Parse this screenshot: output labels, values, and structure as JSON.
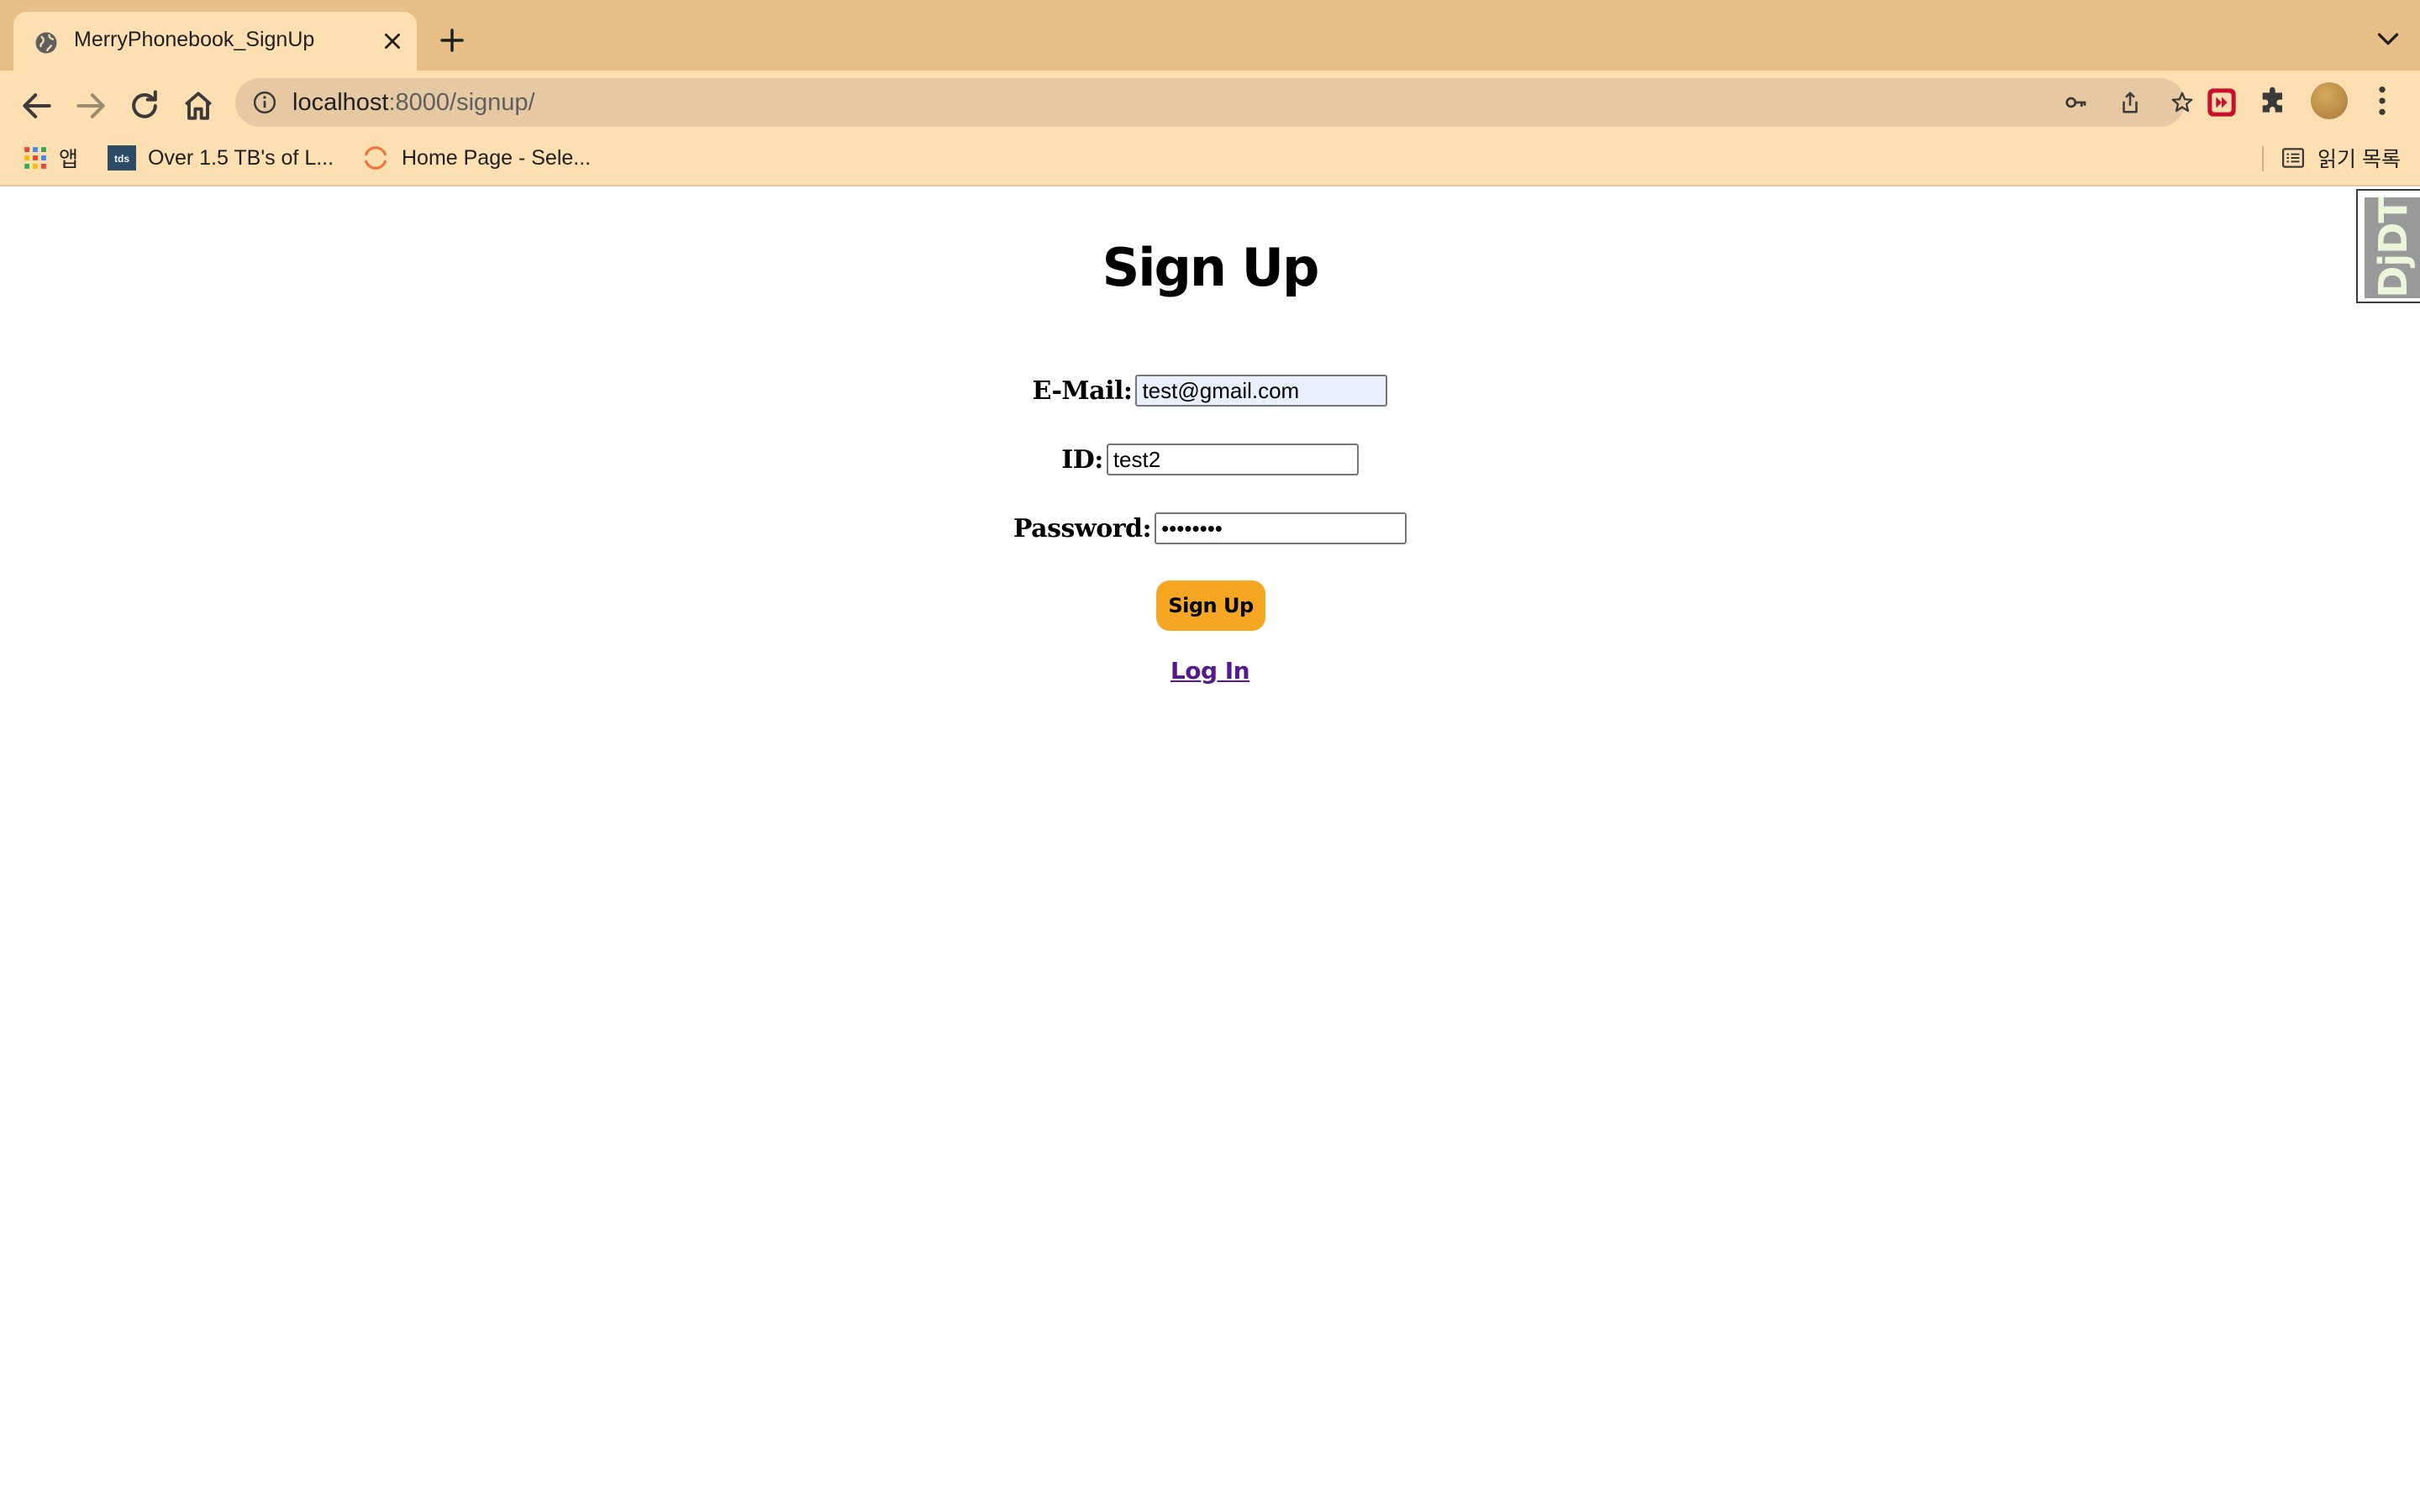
{
  "browser": {
    "tab": {
      "title": "MerryPhonebook_SignUp"
    },
    "address_bar": {
      "host": "localhost",
      "path": ":8000/signup/"
    },
    "bookmarks": [
      {
        "label": "앱",
        "icon": "apps-grid-icon"
      },
      {
        "label": "Over 1.5 TB's of L...",
        "icon": "tds-favicon"
      },
      {
        "label": "Home Page - Sele...",
        "icon": "loading-ring-icon"
      }
    ],
    "reading_list": {
      "label": "읽기 목록"
    }
  },
  "page": {
    "heading": "Sign Up",
    "form": {
      "email": {
        "label": "E-Mail:",
        "value": "test@gmail.com"
      },
      "id": {
        "label": "ID:",
        "value": "test2"
      },
      "password": {
        "label": "Password:",
        "value": "••••••••"
      },
      "submit_label": "Sign Up"
    },
    "login_link": "Log In"
  },
  "djdt": {
    "label": "DjDT"
  },
  "colors": {
    "tabstrip": "#e8bf89",
    "toolbar": "#fedfb2",
    "button": "#f5a623",
    "link": "#551a8b"
  }
}
